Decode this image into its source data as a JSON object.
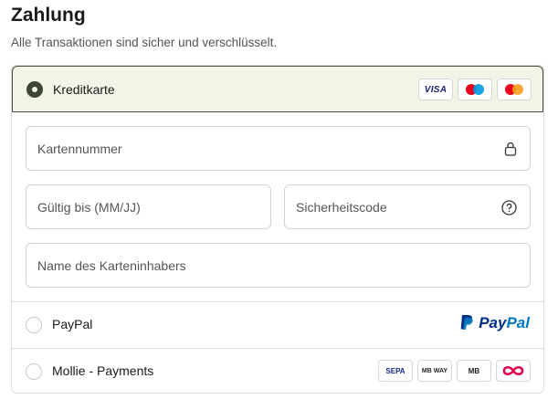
{
  "header": {
    "title": "Zahlung",
    "subtitle": "Alle Transaktionen sind sicher und verschlüsselt."
  },
  "options": {
    "card": {
      "label": "Kreditkarte",
      "selected": true,
      "logos": [
        {
          "name": "visa",
          "text": "VISA"
        },
        {
          "name": "maestro"
        },
        {
          "name": "mastercard"
        }
      ]
    },
    "paypal": {
      "label": "PayPal",
      "selected": false,
      "logo": {
        "pay": "Pay",
        "pal": "Pal"
      }
    },
    "mollie": {
      "label": "Mollie - Payments",
      "selected": false,
      "logos": [
        {
          "name": "sepa",
          "text": "SEPA"
        },
        {
          "name": "mbway",
          "text": "MB WAY"
        },
        {
          "name": "multibanco",
          "text": "MB"
        },
        {
          "name": "infinity"
        }
      ]
    }
  },
  "fields": {
    "card_number": {
      "placeholder": "Kartennummer",
      "icon": "lock-icon"
    },
    "expiry": {
      "placeholder": "Gültig bis (MM/JJ)"
    },
    "cvc": {
      "placeholder": "Sicherheitscode",
      "icon": "help-icon"
    },
    "name": {
      "placeholder": "Name des Karteninhabers"
    }
  },
  "colors": {
    "selected_bg": "#f0f5e8",
    "selected_border": "#4a4f3f",
    "paypal_dark": "#003087",
    "paypal_light": "#0079c1",
    "visa": "#1a1f71",
    "maestro_red": "#eb001b",
    "maestro_blue": "#0099df",
    "mastercard_orange": "#f79e1b"
  }
}
